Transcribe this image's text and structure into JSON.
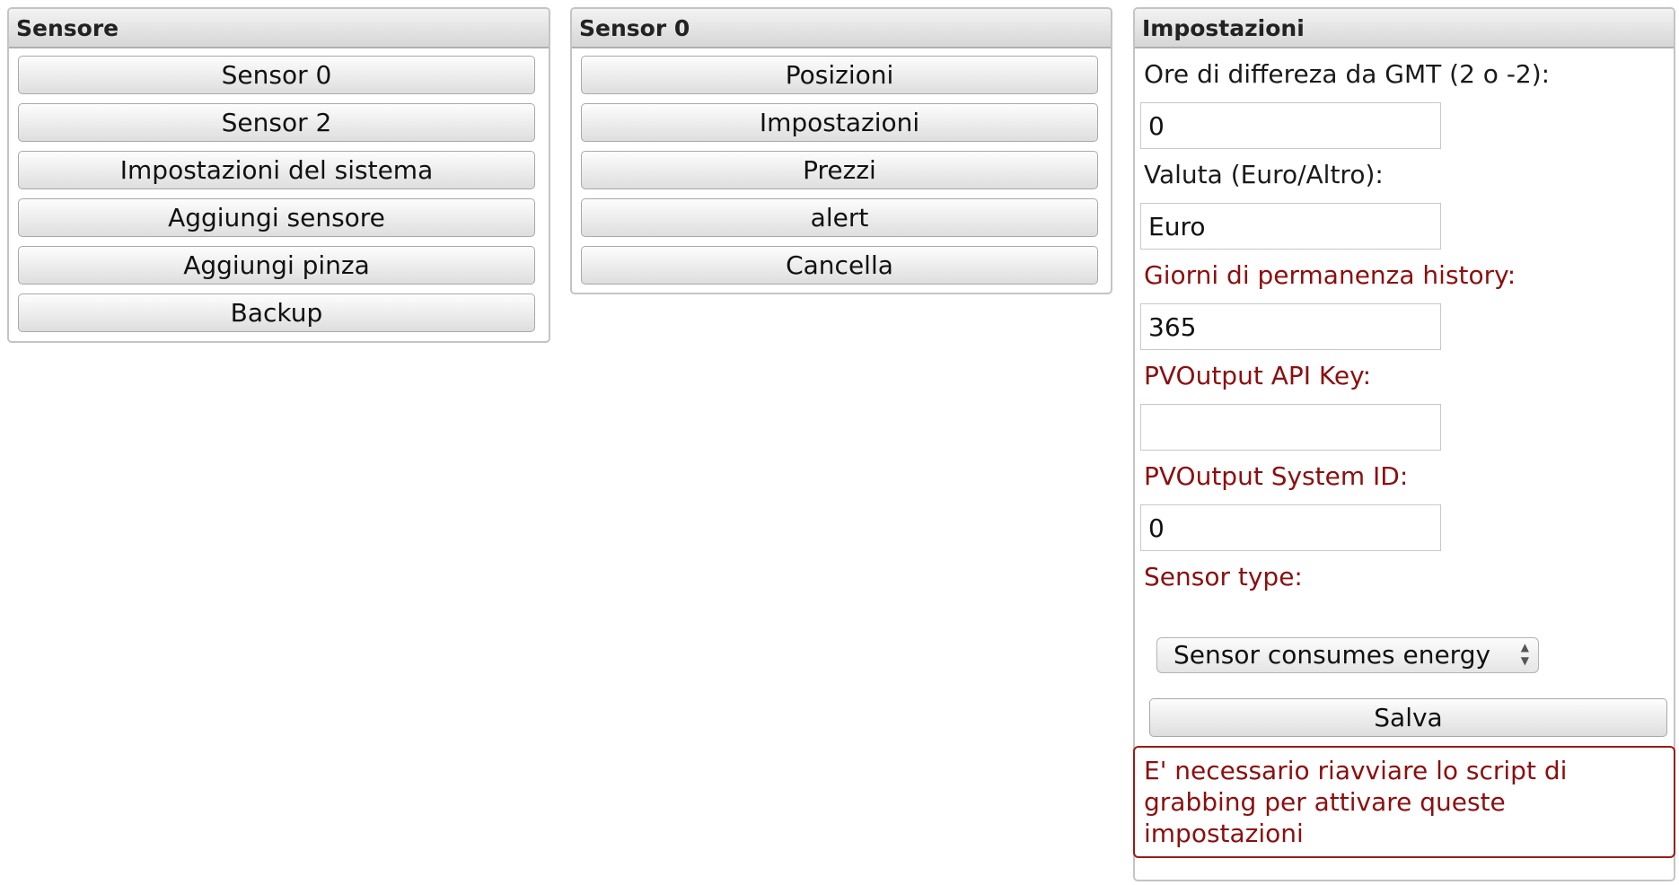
{
  "left_panel": {
    "title": "Sensore",
    "buttons": [
      "Sensor 0",
      "Sensor 2",
      "Impostazioni del sistema",
      "Aggiungi sensore",
      "Aggiungi pinza",
      "Backup"
    ]
  },
  "middle_panel": {
    "title": "Sensor 0",
    "buttons": [
      "Posizioni",
      "Impostazioni",
      "Prezzi",
      "alert",
      "Cancella"
    ]
  },
  "settings_panel": {
    "title": "Impostazioni",
    "gmt_label": "Ore di differeza da GMT (2 o -2):",
    "gmt_value": "0",
    "currency_label": "Valuta (Euro/Altro):",
    "currency_value": "Euro",
    "history_label": "Giorni di permanenza history:",
    "history_value": "365",
    "api_key_label": "PVOutput API Key:",
    "api_key_value": "",
    "system_id_label": "PVOutput System ID:",
    "system_id_value": "0",
    "sensor_type_label": "Sensor type:",
    "sensor_type_selected": "Sensor consumes energy",
    "save_label": "Salva",
    "notice": "E' necessario riavviare lo script di grabbing per attivare queste impostazioni"
  },
  "colors": {
    "required_label": "#8b0f0f",
    "notice_border": "#9b1a1a"
  }
}
